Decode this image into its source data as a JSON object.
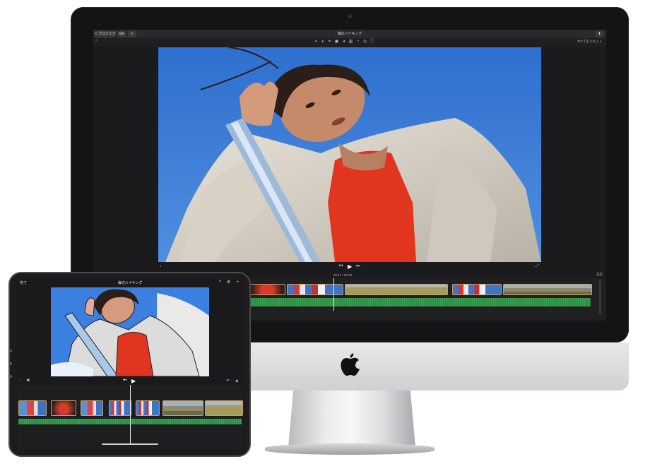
{
  "mac": {
    "app": {
      "back_button": "< プロジェクト",
      "view_button": "⊟▾",
      "import_button": "⇩",
      "title": "海辺ハイキング",
      "share_icon": "share-icon",
      "reset_all": "すべてをリセット"
    },
    "playback": {
      "timecode": "00:12 / 00:30",
      "settings_label": "設定"
    }
  },
  "ipad": {
    "done": "完了",
    "title": "海辺ハイキング"
  },
  "colors": {
    "clip_border": "#caa25a",
    "audio_track": "#2d8d43",
    "sky": "#3b73c8",
    "shirt": "#e2351f"
  }
}
